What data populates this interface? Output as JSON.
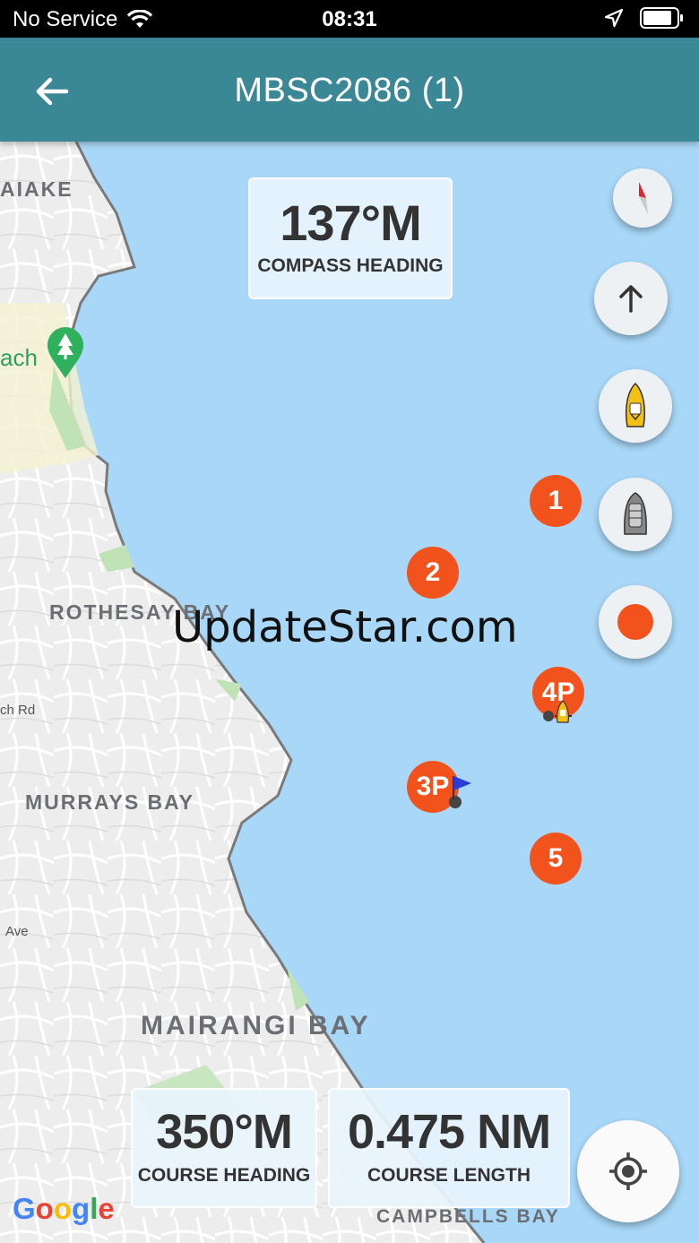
{
  "status_bar": {
    "carrier": "No Service",
    "time": "08:31"
  },
  "app_bar": {
    "title": "MBSC2086 (1)"
  },
  "map": {
    "labels": {
      "waiake": "AIAKE",
      "beach": "ach",
      "rothesay_bay": "ROTHESAY BAY",
      "rd": "ch Rd",
      "murrays_bay": "MURRAYS BAY",
      "ave": "Ave",
      "mairangi_bay": "MAIRANGI BAY",
      "campbells_bay": "CAMPBELLS BAY"
    },
    "markers": [
      {
        "label": "1"
      },
      {
        "label": "2"
      },
      {
        "label": "3P"
      },
      {
        "label": "4P"
      },
      {
        "label": "5"
      }
    ],
    "attribution": "Google"
  },
  "compass_heading": {
    "value": "137°M",
    "label": "COMPASS HEADING"
  },
  "course_heading": {
    "value": "350°M",
    "label": "COURSE HEADING"
  },
  "course_length": {
    "value": "0.475 NM",
    "label": "COURSE LENGTH"
  },
  "watermark": "UpdateStar.com",
  "colors": {
    "app_bar": "#3a8796",
    "water": "#a8d7f7",
    "marker": "#f2531d",
    "record": "#f2531d",
    "land": "#ececec"
  }
}
